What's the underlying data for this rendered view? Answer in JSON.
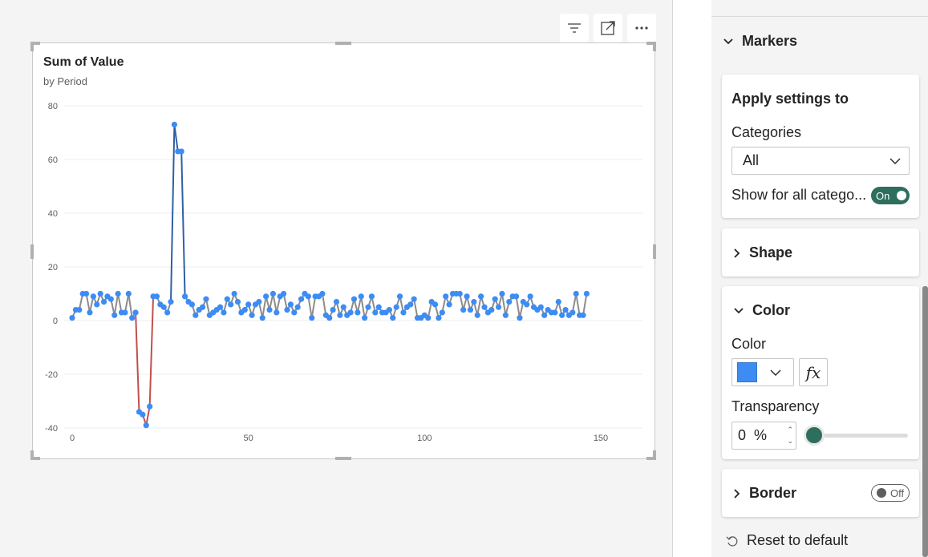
{
  "visual_toolbar": {
    "filter_icon": "filter-icon",
    "focus_icon": "focus-mode-icon",
    "more_icon": "more-options-icon"
  },
  "chart": {
    "title": "Sum of Value",
    "subtitle": "by Period"
  },
  "chart_data": {
    "type": "line",
    "title": "Sum of Value",
    "subtitle": "by Period",
    "xlabel": "",
    "ylabel": "",
    "xlim": [
      0,
      150
    ],
    "ylim": [
      -40,
      80
    ],
    "x_ticks": [
      "0",
      "50",
      "100",
      "150"
    ],
    "y_ticks": [
      "80",
      "60",
      "40",
      "20",
      "0",
      "-20",
      "-40"
    ],
    "grid": true,
    "markers": true,
    "marker_color": "#3d8cf4",
    "line_colors": {
      "negative": "#c0504d",
      "neutral": "#8c8c8c",
      "positive": "#2f5fa7"
    },
    "series": [
      {
        "values": [
          1,
          4,
          4,
          10,
          10,
          3,
          9,
          6,
          10,
          7,
          9,
          8,
          2,
          10,
          3,
          3,
          10,
          1,
          3,
          -34,
          -35,
          -39,
          -32,
          9,
          9,
          6,
          5,
          3,
          7,
          73,
          63,
          63,
          9,
          7,
          6,
          2,
          4,
          5,
          8,
          2,
          3,
          4,
          5,
          3,
          8,
          6,
          10,
          7,
          3,
          4,
          6,
          2,
          6,
          7,
          1,
          9,
          4,
          10,
          3,
          9,
          10,
          4,
          6,
          3,
          5,
          8,
          10,
          9,
          1,
          9,
          9,
          10,
          2,
          1,
          4,
          7,
          2,
          5,
          2,
          3,
          8,
          3,
          9,
          1,
          5,
          9,
          3,
          5,
          3,
          3,
          4,
          1,
          5,
          9,
          3,
          5,
          6,
          8,
          1,
          1,
          2,
          1,
          7,
          6,
          1,
          3,
          9,
          6,
          10,
          10,
          10,
          4,
          9,
          4,
          7,
          2,
          9,
          5,
          3,
          4,
          8,
          5,
          10,
          2,
          7,
          9,
          9,
          1,
          7,
          6,
          9,
          5,
          4,
          5,
          2,
          4,
          3,
          3,
          7,
          2,
          4,
          2,
          3,
          10,
          2,
          2,
          10
        ]
      }
    ]
  },
  "pane": {
    "markers_label": "Markers",
    "apply_title": "Apply settings to",
    "categories_label": "Categories",
    "categories_value": "All",
    "show_all_label": "Show for all catego...",
    "show_all_toggle": "On",
    "shape_label": "Shape",
    "color_section_label": "Color",
    "color_label": "Color",
    "color_value": "#3d8cf4",
    "fx_label": "fx",
    "transparency_label": "Transparency",
    "transparency_value": "0",
    "transparency_unit": "%",
    "transparency_fraction": 0,
    "border_label": "Border",
    "border_toggle": "Off",
    "reset_label": "Reset to default"
  }
}
